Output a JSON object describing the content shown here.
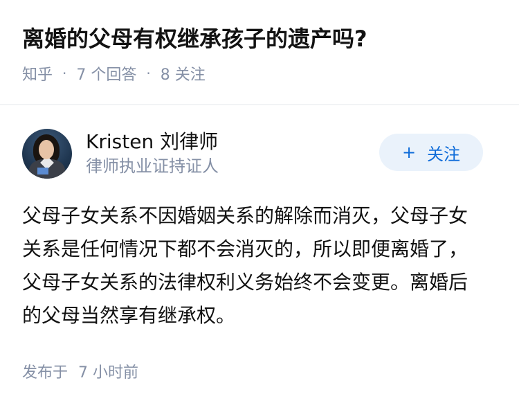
{
  "question": {
    "title": "离婚的父母有权继承孩子的遗产吗?",
    "source": "知乎",
    "answer_count": "7 个回答",
    "follower_count": "8 关注"
  },
  "answer": {
    "author": {
      "name": "Kristen 刘律师",
      "bio": "律师执业证持证人",
      "avatar_icon": "person-portrait"
    },
    "follow_button": {
      "icon": "+",
      "label": "关注",
      "accent": "#0d6bd9",
      "background": "#eaf2fb"
    },
    "content": "父母子女关系不因婚姻关系的解除而消灭，父母子女关系是任何情况下都不会消灭的，所以即便离婚了，父母子女关系的法律权利义务始终不会变更。离婚后的父母当然享有继承权。",
    "published_label": "发布于",
    "published_time": "7 小时前"
  }
}
